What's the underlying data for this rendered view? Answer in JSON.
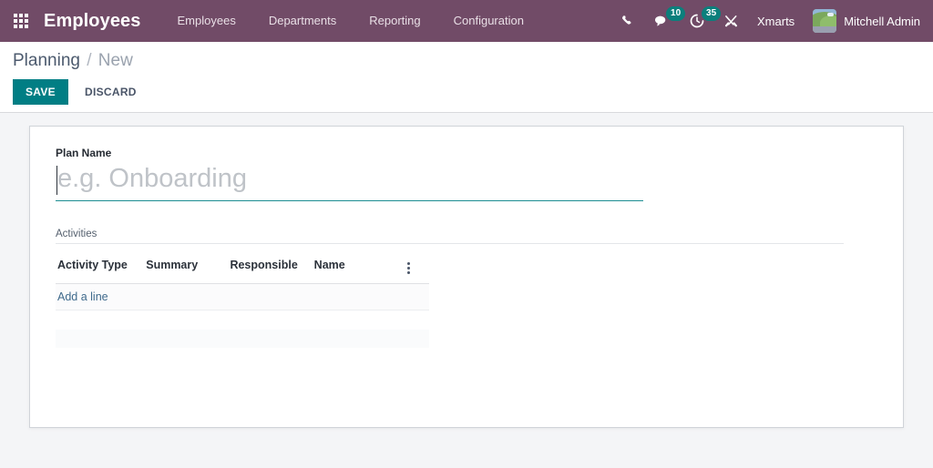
{
  "navbar": {
    "apps_icon": "apps-grid-icon",
    "brand": "Employees",
    "menu": [
      {
        "label": "Employees"
      },
      {
        "label": "Departments"
      },
      {
        "label": "Reporting"
      },
      {
        "label": "Configuration"
      }
    ],
    "systray": [
      {
        "icon": "phone-icon",
        "name": "voip-phone",
        "badge": null
      },
      {
        "icon": "chat-bubble-icon",
        "name": "messages",
        "badge": "10"
      },
      {
        "icon": "clock-activity-icon",
        "name": "activities",
        "badge": "35"
      },
      {
        "icon": "tools-icon",
        "name": "developer-tools",
        "badge": null
      }
    ],
    "database_label": "Xmarts",
    "user": {
      "name": "Mitchell Admin",
      "avatar_icon": "user-avatar"
    }
  },
  "control_panel": {
    "breadcrumb": {
      "root": "Planning",
      "separator": "/",
      "current": "New"
    },
    "buttons": {
      "save": "SAVE",
      "discard": "DISCARD"
    }
  },
  "form": {
    "plan_name": {
      "label": "Plan Name",
      "value": "",
      "placeholder": "e.g. Onboarding"
    },
    "activities": {
      "section_title": "Activities",
      "columns": [
        "Activity Type",
        "Summary",
        "Responsible",
        "Name"
      ],
      "optional_columns_icon": "vertical-dots-icon",
      "rows": [],
      "add_line_label": "Add a line"
    }
  },
  "colors": {
    "navbar": "#714B67",
    "accent_teal": "#017E84",
    "badge": "#0B7F7C",
    "page_background": "#F4F5F7",
    "link": "#3F6A8C"
  }
}
